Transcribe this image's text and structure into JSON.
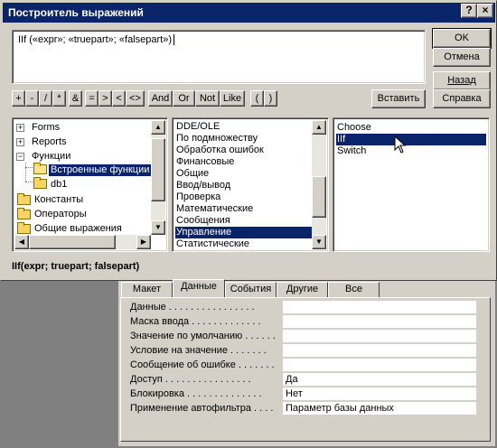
{
  "dialog": {
    "title": "Построитель выражений",
    "help_button": "?",
    "close_button": "×",
    "expression": "IIf («expr»; «truepart»; «falsepart»)"
  },
  "side_buttons": {
    "ok": "OK",
    "cancel": "Отмена",
    "back": "Назад",
    "insert": "Вставить",
    "help": "Справка"
  },
  "operators": [
    "+",
    "-",
    "/",
    "*",
    "&",
    "=",
    ">",
    "<",
    "<>",
    "And",
    "Or",
    "Not",
    "Like",
    "(",
    ")"
  ],
  "left_tree": [
    {
      "label": "Forms",
      "expander": "+"
    },
    {
      "label": "Reports",
      "expander": "+"
    },
    {
      "label": "Функции",
      "expander": "−"
    },
    {
      "label": "Встроенные функции",
      "selected": true
    },
    {
      "label": "db1"
    },
    {
      "label": "Константы"
    },
    {
      "label": "Операторы"
    },
    {
      "label": "Общие выражения"
    }
  ],
  "middle_list": [
    {
      "label": "DDE/OLE"
    },
    {
      "label": "По подмножеству"
    },
    {
      "label": "Обработка ошибок"
    },
    {
      "label": "Финансовые"
    },
    {
      "label": "Общие"
    },
    {
      "label": "Ввод/вывод"
    },
    {
      "label": "Проверка"
    },
    {
      "label": "Математические"
    },
    {
      "label": "Сообщения"
    },
    {
      "label": "Управление",
      "selected": true
    },
    {
      "label": "Статистические"
    }
  ],
  "right_list": [
    {
      "label": "Choose"
    },
    {
      "label": "IIf",
      "selected": true
    },
    {
      "label": "Switch"
    }
  ],
  "syntax": "IIf(expr; truepart; falsepart)",
  "property_sheet": {
    "tabs": [
      {
        "label": "Макет"
      },
      {
        "label": "Данные",
        "active": true
      },
      {
        "label": "События"
      },
      {
        "label": "Другие"
      },
      {
        "label": "Все"
      }
    ],
    "rows": [
      {
        "label": "Данные . . . . . . . . . . . . . . . .",
        "value": ""
      },
      {
        "label": "Маска ввода . . . . . . . . . . . . .",
        "value": ""
      },
      {
        "label": "Значение по умолчанию . . . . . .",
        "value": ""
      },
      {
        "label": "Условие на значение . . . . . . .",
        "value": ""
      },
      {
        "label": "Сообщение об ошибке . . . . . . .",
        "value": ""
      },
      {
        "label": "Доступ . . . . . . . . . . . . . . . .",
        "value": "Да"
      },
      {
        "label": "Блокировка . . . . . . . . . . . . . .",
        "value": "Нет"
      },
      {
        "label": "Применение автофильтра . . . .",
        "value": "Параметр базы данных"
      }
    ]
  },
  "colors": {
    "face": "#d4d0c8",
    "titlebar": "#0a246a",
    "selection": "#0a246a",
    "desktop": "#808080"
  }
}
